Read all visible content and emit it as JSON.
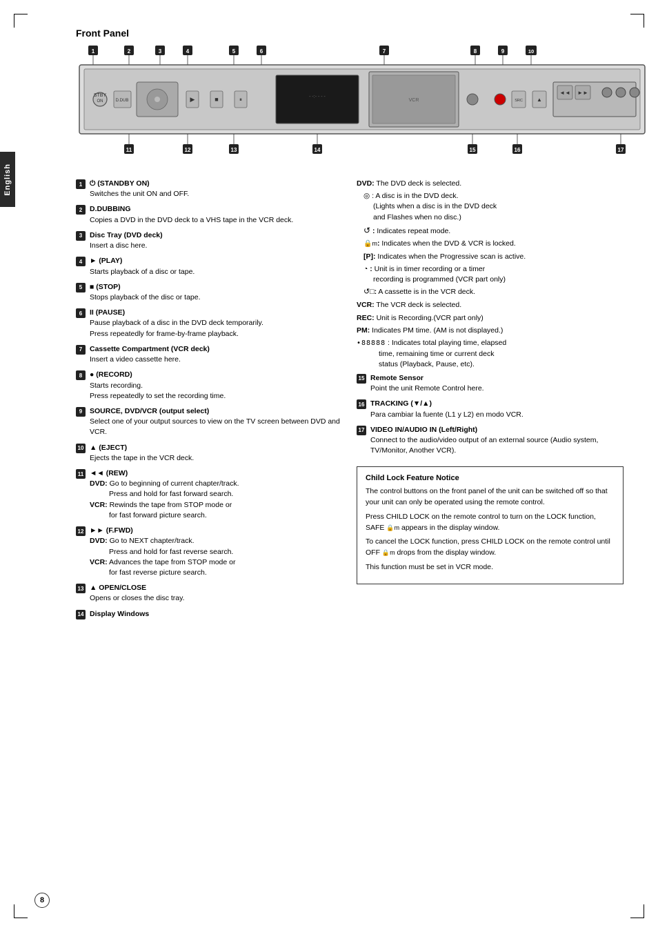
{
  "page": {
    "title": "Front Panel",
    "language_tab": "English",
    "page_number": "8"
  },
  "items_left": [
    {
      "num": "1",
      "title": "(STANDBY ON)",
      "desc": "Switches the unit ON and OFF."
    },
    {
      "num": "2",
      "title": "D.DUBBING",
      "desc": "Copies a DVD in the DVD deck to a VHS tape in the VCR deck."
    },
    {
      "num": "3",
      "title": "Disc Tray (DVD deck)",
      "desc": "Insert a disc here."
    },
    {
      "num": "4",
      "title": "► (PLAY)",
      "desc": "Starts playback of a disc or tape."
    },
    {
      "num": "5",
      "title": "■ (STOP)",
      "desc": "Stops playback of the disc or tape."
    },
    {
      "num": "6",
      "title": "II (PAUSE)",
      "desc": "Pause playback of a disc in the DVD deck temporarily.\nPress repeatedly for frame-by-frame playback."
    },
    {
      "num": "7",
      "title": "Cassette Compartment (VCR deck)",
      "desc": "Insert a video cassette here."
    },
    {
      "num": "8",
      "title": "● (RECORD)",
      "desc": "Starts recording.\nPress repeatedly to set the recording time."
    },
    {
      "num": "9",
      "title": "SOURCE, DVD/VCR (output select)",
      "desc": "Select one of your output sources to view on the TV screen between DVD and VCR."
    },
    {
      "num": "10",
      "title": "▲ (EJECT)",
      "desc": "Ejects the tape in the VCR deck."
    },
    {
      "num": "11",
      "title": "◄◄ (REW)",
      "dvd_label": "DVD:",
      "dvd_desc": "Go to beginning of current chapter/track.\n     Press and hold for fast forward search.",
      "vcr_label": "VCR:",
      "vcr_desc": "Rewinds the tape from STOP mode or\n     for fast forward picture search."
    },
    {
      "num": "12",
      "title": "►► (F.FWD)",
      "dvd_label": "DVD:",
      "dvd_desc": "Go to NEXT chapter/track.\n     Press and hold for fast reverse search.",
      "vcr_label": "VCR:",
      "vcr_desc": "Advances the tape from STOP mode or\n     for fast reverse picture search."
    },
    {
      "num": "13",
      "title": "▲ OPEN/CLOSE",
      "desc": "Opens or closes the disc tray."
    },
    {
      "num": "14",
      "title": "Display Windows",
      "desc": ""
    }
  ],
  "items_right": [
    {
      "label": "DVD:",
      "desc": "The DVD deck is selected."
    },
    {
      "symbol": "disc-icon",
      "desc": "A disc is in the DVD deck.\n(Lights when a disc is in the DVD deck and Flashes when no disc.)"
    },
    {
      "symbol": "repeat-icon",
      "desc": "Indicates repeat mode."
    },
    {
      "symbol": "lock-icon",
      "desc": "Indicates when the DVD & VCR is locked."
    },
    {
      "label": "[P]:",
      "desc": "Indicates when the Progressive scan is active."
    },
    {
      "symbol": "timer-icon",
      "desc": "Unit is in timer recording or a timer recording is programmed (VCR part only)"
    },
    {
      "symbol": "cassette-icon",
      "desc": "A cassette is in the VCR deck."
    },
    {
      "label": "VCR:",
      "desc": "The VCR deck is selected."
    },
    {
      "label": "REC:",
      "desc": "Unit is Recording.(VCR part only)"
    },
    {
      "label": "PM:",
      "desc": "Indicates PM time. (AM is not displayed.)"
    },
    {
      "symbol": "time-display-icon",
      "desc": "Indicates total playing time, elapsed time, remaining time or current deck status (Playback, Pause, etc)."
    },
    {
      "num": "15",
      "title": "Remote Sensor",
      "desc": "Point the unit Remote Control here."
    },
    {
      "num": "16",
      "title": "TRACKING (▼/▲)",
      "desc": "Para cambiar la fuente (L1 y L2) en modo VCR."
    },
    {
      "num": "17",
      "title": "VIDEO IN/AUDIO IN (Left/Right)",
      "desc": "Connect to the audio/video output of an external source (Audio system, TV/Monitor, Another VCR)."
    }
  ],
  "child_lock": {
    "title": "Child Lock Feature Notice",
    "paragraphs": [
      "The control buttons on the front panel of the unit can be switched off so that your unit can only be operated using the remote control.",
      "Press CHILD LOCK on the remote control to turn on the LOCK function, SAFE  appears in the display window.",
      "To cancel the LOCK function, press CHILD LOCK on the remote control until OFF  drops from the display window.",
      "This function must be set in VCR mode."
    ]
  },
  "top_numbers": [
    "1",
    "2",
    "3",
    "4",
    "5",
    "6",
    "7",
    "8",
    "9",
    "10"
  ],
  "bottom_numbers": [
    "11",
    "12",
    "13",
    "14",
    "15",
    "16",
    "17"
  ]
}
